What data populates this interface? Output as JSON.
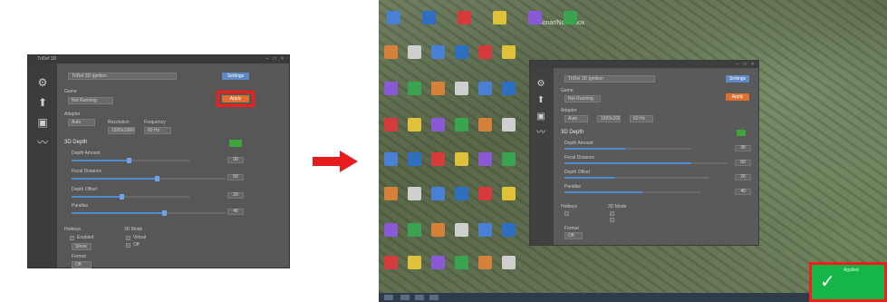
{
  "left_window": {
    "title": "TriDef 3D",
    "window_controls": "– □ ×",
    "rail_icons": [
      "gear-icon",
      "profile-icon",
      "display-icon",
      "chart-icon"
    ],
    "profile_field": "TriDef 3D Ignition",
    "profile_button": "Settings",
    "game_label": "Game",
    "game_value": "Not Running",
    "apply_button": "Apply",
    "adapter_label": "Adapter",
    "adapter_value": "Auto",
    "res_label": "Resolution",
    "res_value": "1920x1080",
    "freq_label": "Frequency",
    "freq_value": "60 Hz",
    "section_label": "3D Depth",
    "sliders": [
      {
        "label": "Depth Amount",
        "value": "30",
        "fill": 0.48
      },
      {
        "label": "Focal Distance",
        "value": "50",
        "fill": 0.55
      },
      {
        "label": "Depth Offset",
        "value": "20",
        "fill": 0.42
      },
      {
        "label": "Parallax",
        "value": "40",
        "fill": 0.6
      }
    ],
    "group_a_label": "Hotkeys",
    "group_a_items": [
      "Enabled",
      "Show"
    ],
    "group_b_label": "3D Mode",
    "group_b_items": [
      "Virtual",
      "Off"
    ],
    "group_c_label": "Format",
    "group_c_value": "Off"
  },
  "arrow_color": "#e81c1c",
  "desktop": {
    "top_label": "Sonar/NoteXbox",
    "icon_colors": [
      "#4a7fd6",
      "#2e6fc2",
      "#d63b3b",
      "#e0c23a",
      "#8a5ad6",
      "#3aa34f",
      "#d6813a",
      "#cfcfcf"
    ],
    "window": {
      "profile_field": "TriDef 3D Ignition",
      "profile_button": "Settings",
      "game_label": "Game",
      "game_value": "Not Running",
      "apply_button": "Apply",
      "adapter_label": "Adapter",
      "adapter_value": "Auto",
      "section_label": "3D Depth",
      "sliders": [
        {
          "label": "Depth Amount",
          "value": "30",
          "fill": 0.48
        },
        {
          "label": "Focal Distance",
          "value": "50",
          "fill": 0.78
        },
        {
          "label": "Depth Offset",
          "value": "20",
          "fill": 0.35
        },
        {
          "label": "Parallax",
          "value": "40",
          "fill": 0.57
        }
      ],
      "group_a_label": "Hotkeys",
      "group_b_label": "3D Mode",
      "group_c_label": "Format"
    },
    "toast": {
      "text": "Applied"
    }
  }
}
